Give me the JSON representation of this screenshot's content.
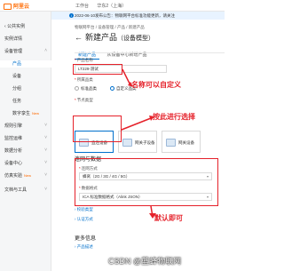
{
  "topbar": {
    "logo_text": "阿里云",
    "nav": [
      "工作台",
      "华东2（上海）"
    ]
  },
  "sidebar": {
    "items": [
      {
        "label": "公共实例",
        "type": "back"
      },
      {
        "label": "实例详情",
        "type": "top"
      },
      {
        "label": "设备管理",
        "type": "top"
      },
      {
        "label": "产品",
        "type": "sub",
        "active": true
      },
      {
        "label": "设备",
        "type": "sub"
      },
      {
        "label": "分组",
        "type": "sub"
      },
      {
        "label": "任务",
        "type": "sub"
      },
      {
        "label": "数字孪生",
        "type": "sub",
        "badge": "New"
      },
      {
        "label": "规则引擎",
        "type": "top"
      },
      {
        "label": "监控运维",
        "type": "top"
      },
      {
        "label": "数据分析",
        "type": "top"
      },
      {
        "label": "设备中心",
        "type": "top"
      },
      {
        "label": "仿真实验",
        "type": "top",
        "badge": "New"
      },
      {
        "label": "文档与工具",
        "type": "top"
      }
    ]
  },
  "main": {
    "notice": "2022-06-10发布公告：物联网平台标准功能更新，请关注",
    "breadcrumb": "物联网平台 / 设备管理 / 产品 / 新建产品",
    "title": "新建产品",
    "title_sub": "（设备模型）",
    "tabs": [
      "新建产品",
      "从设备中心新增产品"
    ],
    "form": {
      "product_name_label": "产品名称",
      "product_name_value": "LT229-测试",
      "category_label": "所属品类",
      "category_options": [
        "标准品类",
        "自定义品类"
      ],
      "node_type_label": "节点类型",
      "node_cards": [
        "直连设备",
        "网关子设备",
        "网关设备"
      ],
      "network_section": "连网与数据",
      "conn_label": "连网方式",
      "conn_value": "蜂窝（2G / 3G / 4G / 5G）",
      "data_label": "数据格式",
      "data_value": "ICA 标准数据格式（Alink JSON）",
      "verify_link": "校验类型",
      "auth_link": "认证方式",
      "more_section": "更多信息",
      "desc_link": "产品描述"
    }
  },
  "annotations": {
    "name_note": "名称可以自定义",
    "select_note": "按此进行选择",
    "default_note": "默认即可"
  },
  "watermark": "CSDN @蓝蜂物联网",
  "colors": {
    "annotation_red": "#e5212a",
    "accent_blue": "#0070cc",
    "brand_orange": "#ff6a00"
  }
}
